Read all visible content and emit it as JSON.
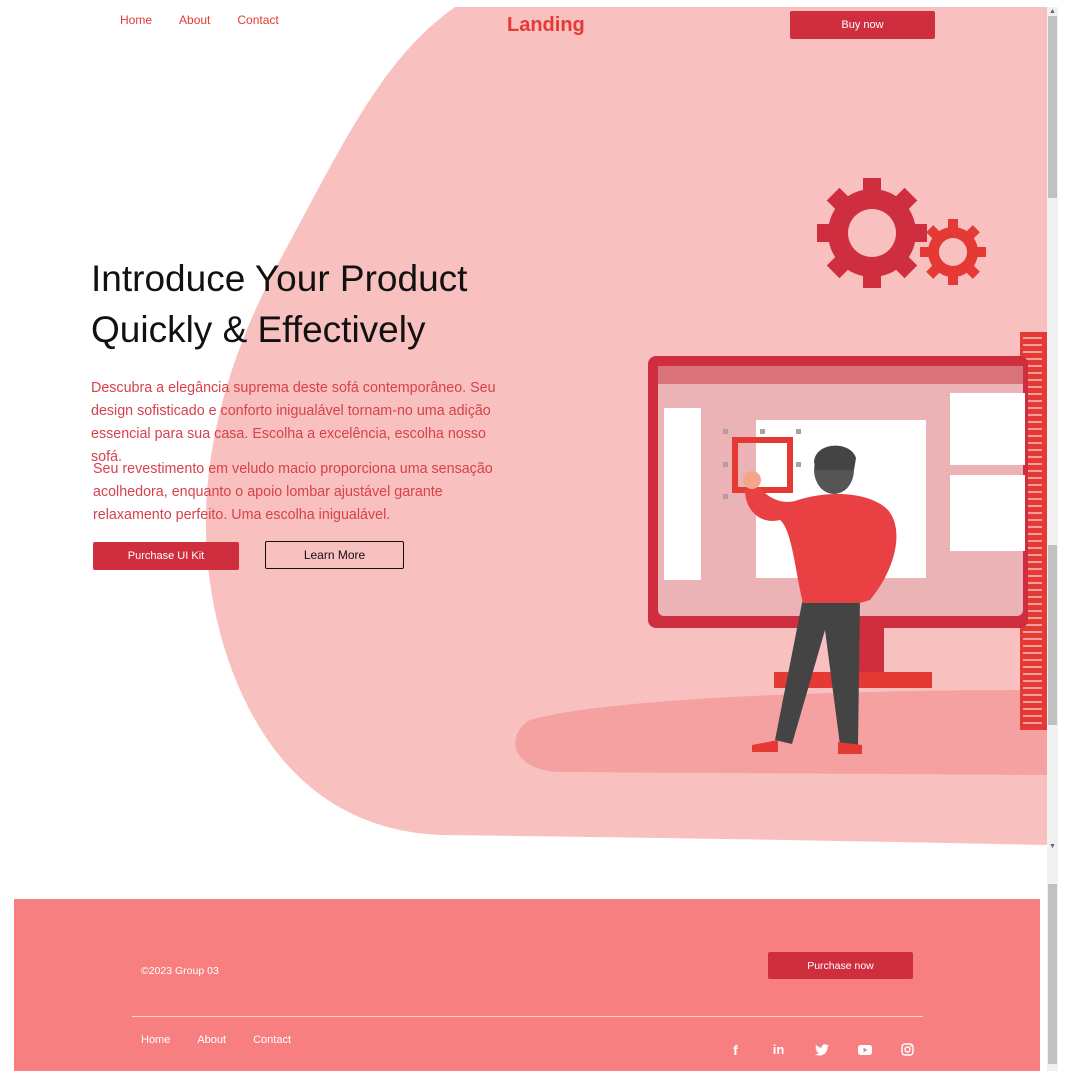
{
  "header": {
    "nav": [
      "Home",
      "About",
      "Contact"
    ],
    "logo": "Landing",
    "buy_label": "Buy now"
  },
  "hero": {
    "title_line1": "Introduce Your Product",
    "title_line2": "Quickly & Effectively",
    "paragraph1": "Descubra a elegância suprema deste sofá contemporâneo. Seu design sofisticado e conforto inigualável tornam-no uma adição essencial para sua casa. Escolha a excelência, escolha nosso sofá.",
    "paragraph2": "Seu revestimento em veludo macio proporciona uma sensação acolhedora, enquanto o apoio lombar ajustável garante relaxamento perfeito. Uma escolha inigualável.",
    "primary_button": "Purchase UI Kit",
    "secondary_button": "Learn More"
  },
  "footer": {
    "copyright": "©2023 Group 03",
    "purchase_label": "Purchase now",
    "nav": [
      "Home",
      "About",
      "Contact"
    ],
    "social_icons": [
      "facebook-icon",
      "linkedin-icon",
      "twitter-icon",
      "youtube-icon",
      "instagram-icon"
    ],
    "social_glyphs": [
      "f",
      "in"
    ]
  },
  "colors": {
    "accent": "#e53935",
    "button": "#cf2e3e",
    "blob": "#f9c0c0",
    "footer": "#f77f80"
  }
}
